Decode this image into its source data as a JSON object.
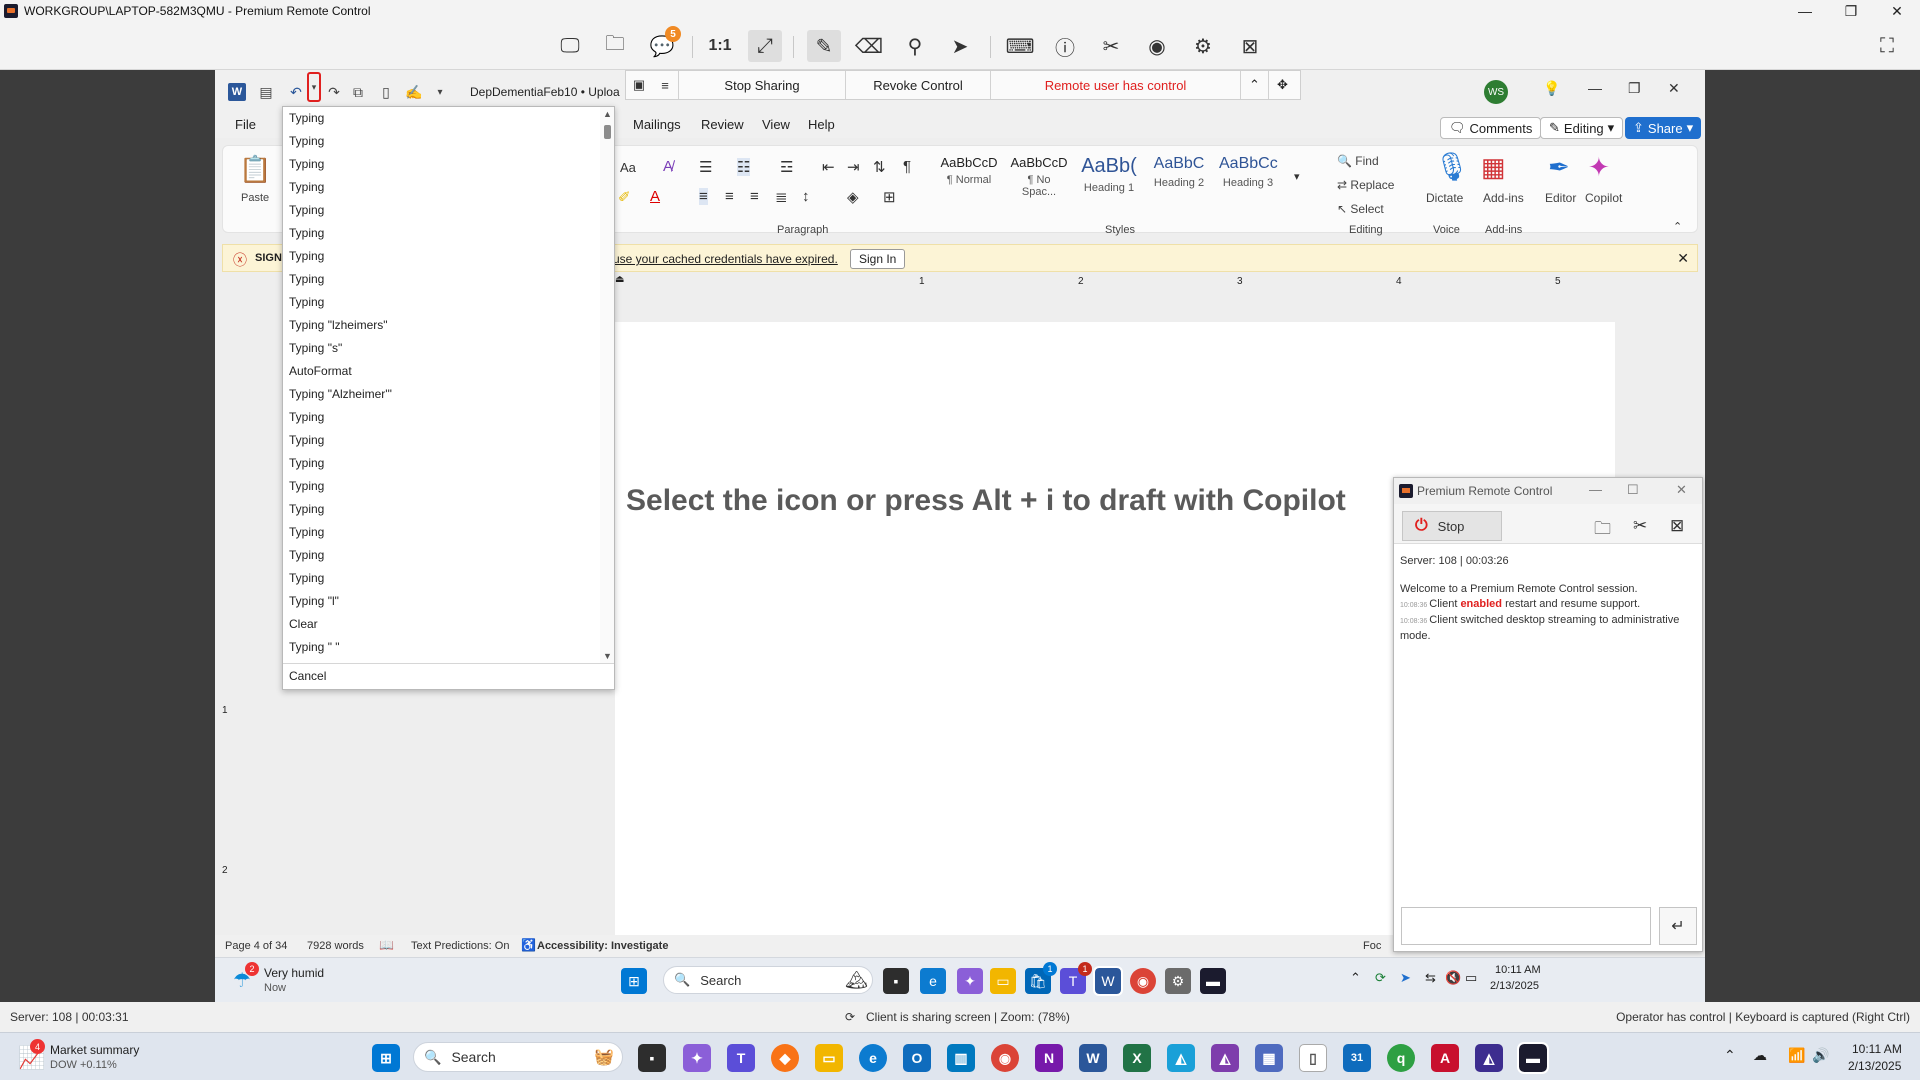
{
  "outer_window": {
    "title": "WORKGROUP\\LAPTOP-582M3QMU - Premium Remote Control",
    "toolbar": {
      "zoom_label": "1:1",
      "chat_badge": "5"
    }
  },
  "share_bar": {
    "stop_sharing": "Stop Sharing",
    "revoke_control": "Revoke Control",
    "remote_status": "Remote user has control"
  },
  "word": {
    "doc_name": "DepDementiaFeb10 • Uploa",
    "avatar_initials": "WS",
    "tabs": [
      "File",
      "Mailings",
      "Review",
      "View",
      "Help"
    ],
    "comments_label": "Comments",
    "editing_label": "Editing",
    "share_label": "Share",
    "ribbon": {
      "paste_label": "Paste",
      "paragraph_label": "Paragraph",
      "styles_label": "Styles",
      "editing_group_label": "Editing",
      "voice_label": "Voice",
      "addins_group_label": "Add-ins",
      "font_size_btn": "Aa",
      "styles": [
        {
          "preview": "AaBbCcD",
          "name": "¶ Normal"
        },
        {
          "preview": "AaBbCcD",
          "name": "¶ No Spac..."
        },
        {
          "preview": "AaBb(",
          "name": "Heading 1"
        },
        {
          "preview": "AaBbC",
          "name": "Heading 2"
        },
        {
          "preview": "AaBbCc",
          "name": "Heading 3"
        }
      ],
      "find_label": "Find",
      "replace_label": "Replace",
      "select_label": "Select",
      "dictate_label": "Dictate",
      "addins_label": "Add-ins",
      "editor_label": "Editor",
      "copilot_label": "Copilot"
    },
    "message_bar": {
      "prefix": "SIGN",
      "text": "use your cached credentials have expired.",
      "sign_in": "Sign In"
    },
    "ruler_numbers": [
      "1",
      "2",
      "3",
      "4",
      "5"
    ],
    "vruler_numbers": [
      "1",
      "2"
    ],
    "copilot_hint": "Select the icon or press Alt + i to draft with Copilot",
    "status": {
      "page": "Page 4 of 34",
      "words": "7928 words",
      "predictions": "Text Predictions: On",
      "accessibility": "Accessibility: Investigate",
      "focus": "Foc"
    }
  },
  "undo_list": {
    "items": [
      "Typing",
      "Typing",
      "Typing",
      "Typing",
      "Typing",
      "Typing",
      "Typing",
      "Typing",
      "Typing",
      "Typing \"lzheimers\"",
      "Typing \"s\"",
      "AutoFormat",
      "Typing \"Alzheimer'\"",
      "Typing",
      "Typing",
      "Typing",
      "Typing",
      "Typing",
      "Typing",
      "Typing",
      "Typing",
      "Typing \"l\"",
      "Clear",
      "Typing \" \""
    ],
    "cancel": "Cancel"
  },
  "inner_taskbar": {
    "weather_temp_badge": "2",
    "weather_title": "Very humid",
    "weather_sub": "Now",
    "search_label": "Search",
    "teams_badge": "1",
    "onenote_badge": "1"
  },
  "prc_window": {
    "title": "Premium Remote Control",
    "stop_label": "Stop",
    "server_info": "Server: 108 | 00:03:26",
    "log": [
      {
        "ts": "",
        "pre": "Welcome to a Premium Remote Control session.",
        "em": "",
        "post": ""
      },
      {
        "ts": "10:08:36",
        "pre": "Client ",
        "em": "enabled",
        "post": " restart and resume support."
      },
      {
        "ts": "10:08:36",
        "pre": "Client switched desktop streaming to administrative mode.",
        "em": "",
        "post": ""
      }
    ]
  },
  "outer_status": {
    "server": "Server: 108 | 00:03:31",
    "center": "Client is sharing screen | Zoom: (78%)",
    "right": "Operator has control | Keyboard is captured (Right Ctrl)"
  },
  "inner_tray": {
    "time": "10:11 AM",
    "date": "2/13/2025"
  },
  "host_taskbar": {
    "market_badge": "4",
    "market_title": "Market summary",
    "market_sub": "DOW +0.11%",
    "search_label": "Search",
    "time": "10:11 AM",
    "date": "2/13/2025",
    "calendar_badge": "31"
  }
}
